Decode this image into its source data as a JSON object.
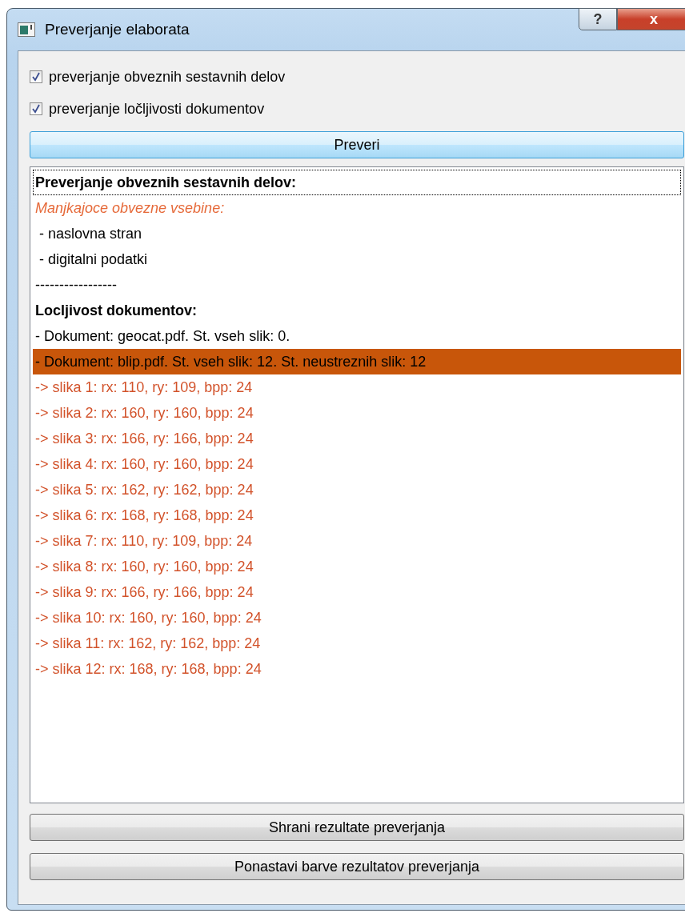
{
  "window": {
    "title": "Preverjanje elaborata",
    "help_button": "?",
    "close_button": "x"
  },
  "options": [
    {
      "label": "preverjanje obveznih sestavnih delov",
      "checked": true
    },
    {
      "label": "preverjanje ločljivosti dokumentov",
      "checked": true
    }
  ],
  "check_button": "Preveri",
  "results": [
    {
      "kind": "heading",
      "text": "Preverjanje obveznih sestavnih delov:",
      "selected": false,
      "focused": true
    },
    {
      "kind": "note",
      "text": "Manjkajoce obvezne vsebine:",
      "selected": false,
      "focused": false
    },
    {
      "kind": "item",
      "text": " - naslovna stran",
      "selected": false,
      "focused": false
    },
    {
      "kind": "item",
      "text": " - digitalni podatki",
      "selected": false,
      "focused": false
    },
    {
      "kind": "item",
      "text": "-----------------",
      "selected": false,
      "focused": false
    },
    {
      "kind": "heading",
      "text": "Locljivost dokumentov:",
      "selected": false,
      "focused": false
    },
    {
      "kind": "item",
      "text": "- Dokument: geocat.pdf. St. vseh slik: 0.",
      "selected": false,
      "focused": false
    },
    {
      "kind": "item",
      "text": "- Dokument: blip.pdf. St. vseh slik: 12. St. neustreznih slik: 12",
      "selected": true,
      "focused": false
    },
    {
      "kind": "error",
      "text": "-> slika 1: rx: 110, ry: 109, bpp: 24",
      "selected": false,
      "focused": false
    },
    {
      "kind": "error",
      "text": "-> slika 2: rx: 160, ry: 160, bpp: 24",
      "selected": false,
      "focused": false
    },
    {
      "kind": "error",
      "text": "-> slika 3: rx: 166, ry: 166, bpp: 24",
      "selected": false,
      "focused": false
    },
    {
      "kind": "error",
      "text": "-> slika 4: rx: 160, ry: 160, bpp: 24",
      "selected": false,
      "focused": false
    },
    {
      "kind": "error",
      "text": "-> slika 5: rx: 162, ry: 162, bpp: 24",
      "selected": false,
      "focused": false
    },
    {
      "kind": "error",
      "text": "-> slika 6: rx: 168, ry: 168, bpp: 24",
      "selected": false,
      "focused": false
    },
    {
      "kind": "error",
      "text": "-> slika 7: rx: 110, ry: 109, bpp: 24",
      "selected": false,
      "focused": false
    },
    {
      "kind": "error",
      "text": "-> slika 8: rx: 160, ry: 160, bpp: 24",
      "selected": false,
      "focused": false
    },
    {
      "kind": "error",
      "text": "-> slika 9: rx: 166, ry: 166, bpp: 24",
      "selected": false,
      "focused": false
    },
    {
      "kind": "error",
      "text": "-> slika 10: rx: 160, ry: 160, bpp: 24",
      "selected": false,
      "focused": false
    },
    {
      "kind": "error",
      "text": "-> slika 11: rx: 162, ry: 162, bpp: 24",
      "selected": false,
      "focused": false
    },
    {
      "kind": "error",
      "text": "-> slika 12: rx: 168, ry: 168, bpp: 24",
      "selected": false,
      "focused": false
    }
  ],
  "buttons": [
    "Shrani rezultate preverjanja",
    "Ponastavi barve rezultatov preverjanja"
  ]
}
